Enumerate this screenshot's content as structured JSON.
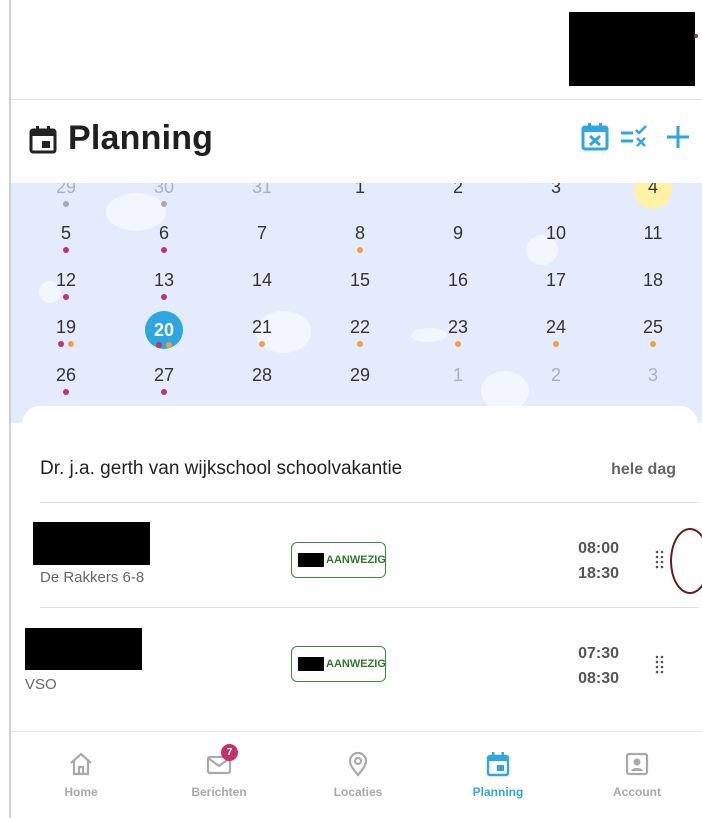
{
  "header": {
    "title": "Planning"
  },
  "calendar": {
    "weeks": [
      [
        {
          "d": "29",
          "m": true,
          "dots": [
            "grey"
          ]
        },
        {
          "d": "30",
          "m": true,
          "dots": [
            "grey"
          ]
        },
        {
          "d": "31",
          "m": true,
          "dots": []
        },
        {
          "d": "1",
          "dots": []
        },
        {
          "d": "2",
          "dots": []
        },
        {
          "d": "3",
          "dots": []
        },
        {
          "d": "4",
          "hl": true,
          "dots": []
        }
      ],
      [
        {
          "d": "5",
          "dots": [
            "pink"
          ]
        },
        {
          "d": "6",
          "dots": [
            "pink"
          ]
        },
        {
          "d": "7",
          "dots": []
        },
        {
          "d": "8",
          "dots": [
            "orange"
          ]
        },
        {
          "d": "9",
          "dots": []
        },
        {
          "d": "10",
          "dots": []
        },
        {
          "d": "11",
          "dots": []
        }
      ],
      [
        {
          "d": "12",
          "dots": [
            "pink"
          ]
        },
        {
          "d": "13",
          "dots": [
            "pink"
          ]
        },
        {
          "d": "14",
          "dots": []
        },
        {
          "d": "15",
          "dots": []
        },
        {
          "d": "16",
          "dots": []
        },
        {
          "d": "17",
          "dots": []
        },
        {
          "d": "18",
          "dots": []
        }
      ],
      [
        {
          "d": "19",
          "dots": [
            "pink",
            "orange"
          ]
        },
        {
          "d": "20",
          "today": true,
          "dots": [
            "pink",
            "orange"
          ]
        },
        {
          "d": "21",
          "dots": [
            "orange"
          ]
        },
        {
          "d": "22",
          "dots": [
            "orange"
          ]
        },
        {
          "d": "23",
          "dots": [
            "orange"
          ]
        },
        {
          "d": "24",
          "dots": [
            "orange"
          ]
        },
        {
          "d": "25",
          "dots": [
            "orange"
          ]
        }
      ],
      [
        {
          "d": "26",
          "dots": [
            "pink"
          ]
        },
        {
          "d": "27",
          "dots": [
            "pink"
          ]
        },
        {
          "d": "28",
          "dots": []
        },
        {
          "d": "29",
          "dots": []
        },
        {
          "d": "1",
          "m": true,
          "dots": []
        },
        {
          "d": "2",
          "m": true,
          "dots": []
        },
        {
          "d": "3",
          "m": true,
          "dots": []
        }
      ]
    ]
  },
  "event": {
    "title": "Dr. j.a. gerth van wijkschool schoolvakantie",
    "time": "hele dag"
  },
  "items": [
    {
      "location": "De Rakkers 6-8",
      "badge": "AANWEZIG",
      "start": "08:00",
      "end": "18:30"
    },
    {
      "location": "VSO",
      "badge": "AANWEZIG",
      "start": "07:30",
      "end": "08:30"
    }
  ],
  "tabs": [
    {
      "label": "Home",
      "icon": "home-icon"
    },
    {
      "label": "Berichten",
      "icon": "mail-icon",
      "badge": "7"
    },
    {
      "label": "Locaties",
      "icon": "location-pin-icon"
    },
    {
      "label": "Planning",
      "icon": "calendar-icon",
      "active": true
    },
    {
      "label": "Account",
      "icon": "account-icon"
    }
  ],
  "colors": {
    "accent": "#2ea7e0",
    "pink_dot": "#c0336e",
    "orange_dot": "#f0a040",
    "calendar_bg": "#e3ebfd",
    "badge_green": "#2d7a2d"
  }
}
